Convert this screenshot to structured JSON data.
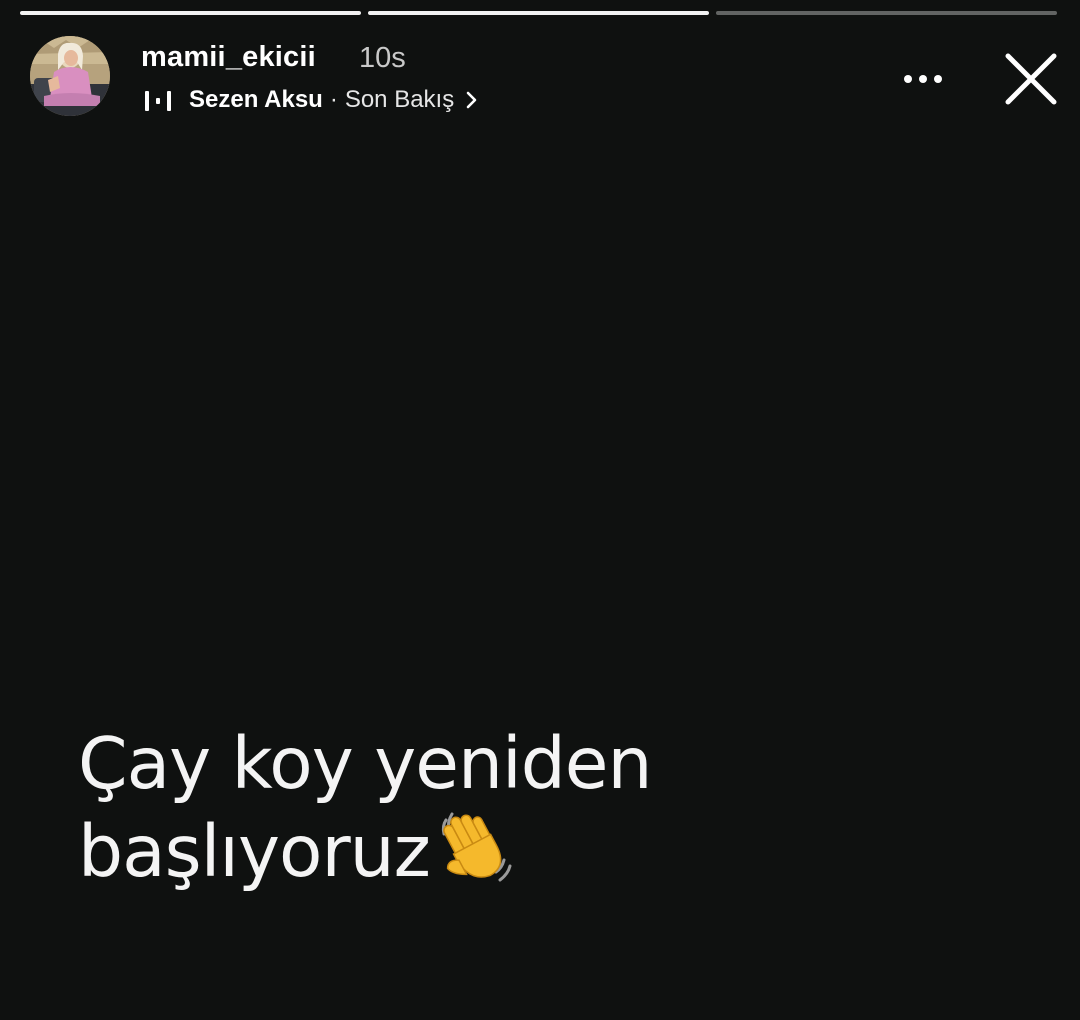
{
  "story": {
    "progress": [
      1.0,
      1.0,
      0.0
    ],
    "user": {
      "username": "mamii_ekicii",
      "time_ago": "10s",
      "avatar_icon": "profile-avatar"
    },
    "music": {
      "icon": "music-bars-icon",
      "artist": "Sezen Aksu",
      "separator": "·",
      "song": "Son Bakış"
    },
    "actions": {
      "more_icon": "more-options-icon",
      "close_icon": "close-icon"
    },
    "text": {
      "line1": "Çay koy yeniden",
      "line2": "başlıyoruz",
      "emoji_icon": "waving-hand-icon"
    },
    "colors": {
      "background": "#0f1110",
      "text": "#f4f4f4",
      "progress_active": "#f2f2f2",
      "wave_hand": "#f5b92c"
    }
  }
}
